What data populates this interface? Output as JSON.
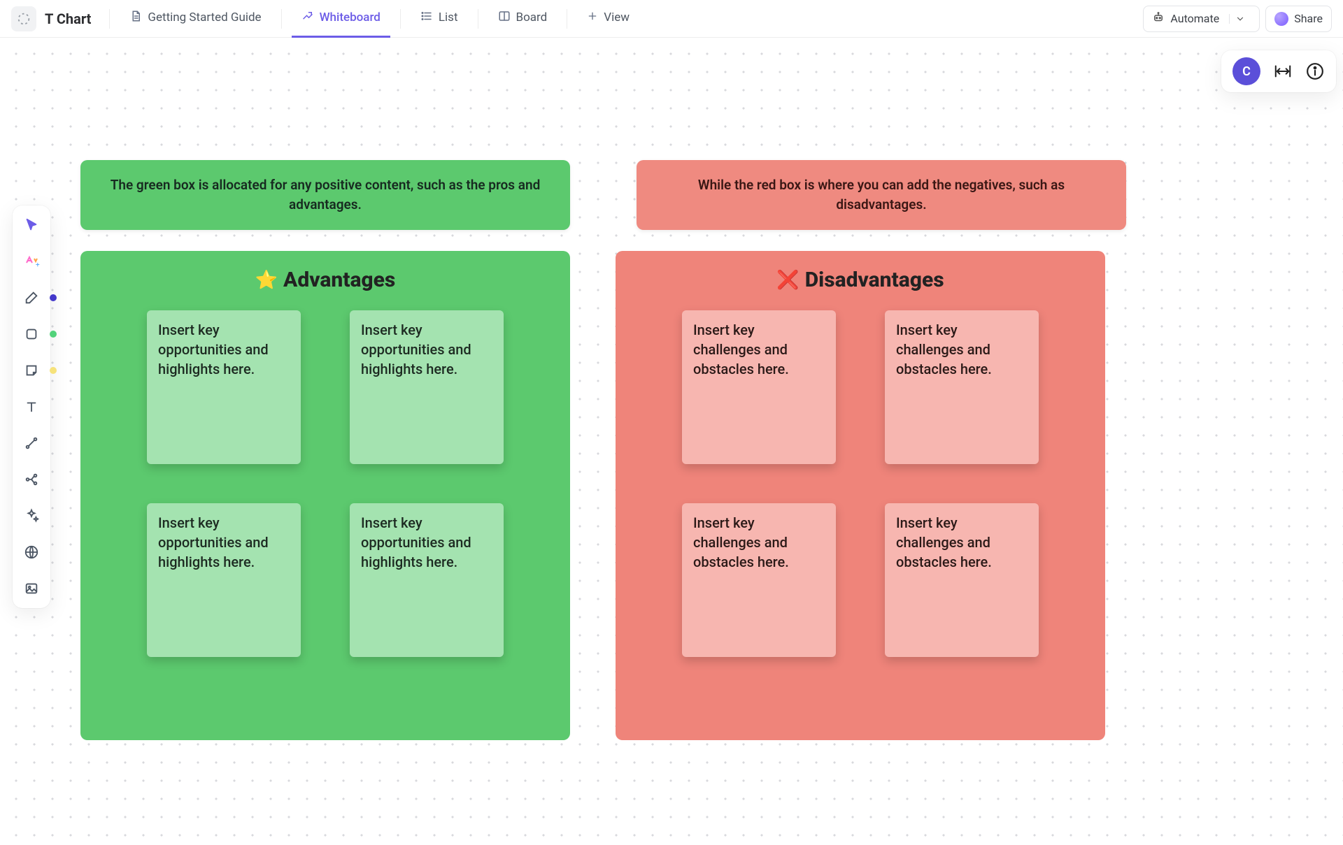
{
  "header": {
    "title": "T Chart",
    "tabs": [
      {
        "id": "getting_started",
        "label": "Getting Started Guide",
        "active": false
      },
      {
        "id": "whiteboard",
        "label": "Whiteboard",
        "active": true
      },
      {
        "id": "list",
        "label": "List",
        "active": false
      },
      {
        "id": "board",
        "label": "Board",
        "active": false
      }
    ],
    "add_view_label": "View",
    "automate_label": "Automate",
    "share_label": "Share"
  },
  "user": {
    "avatar_initial": "C"
  },
  "colors": {
    "accent": "#6c5ce7",
    "green": "#5cc96e",
    "red": "#ef847a"
  },
  "info_cards": {
    "green": "The green box is allocated for any positive content, such as the pros and advantages.",
    "red": "While the red box is where you can add the negatives, such as disadvantages."
  },
  "panels": {
    "advantages": {
      "title": "Advantages",
      "emoji": "⭐",
      "notes": [
        "Insert key opportunities and highlights here.",
        "Insert key opportunities and highlights here.",
        "Insert key opportunities and highlights here.",
        "Insert key opportunities and highlights here."
      ]
    },
    "disadvantages": {
      "title": "Disadvantages",
      "emoji": "❌",
      "notes": [
        "Insert key challenges and obstacles here.",
        "Insert key challenges and obstacles here.",
        "Insert key challenges and obstacles here.",
        "Insert key challenges and obstacles here."
      ]
    }
  },
  "left_toolbar": {
    "items": [
      {
        "name": "select",
        "label": "Select",
        "active": true
      },
      {
        "name": "ai",
        "label": "AI"
      },
      {
        "name": "pen",
        "label": "Pen",
        "indicator": "blue"
      },
      {
        "name": "shape",
        "label": "Shape",
        "indicator": "green"
      },
      {
        "name": "sticky",
        "label": "Sticky note",
        "indicator": "yellow"
      },
      {
        "name": "text",
        "label": "Text"
      },
      {
        "name": "connector",
        "label": "Connector"
      },
      {
        "name": "mindmap",
        "label": "Mind map"
      },
      {
        "name": "stars",
        "label": "Templates"
      },
      {
        "name": "web",
        "label": "Embed"
      },
      {
        "name": "image",
        "label": "Image"
      }
    ]
  }
}
